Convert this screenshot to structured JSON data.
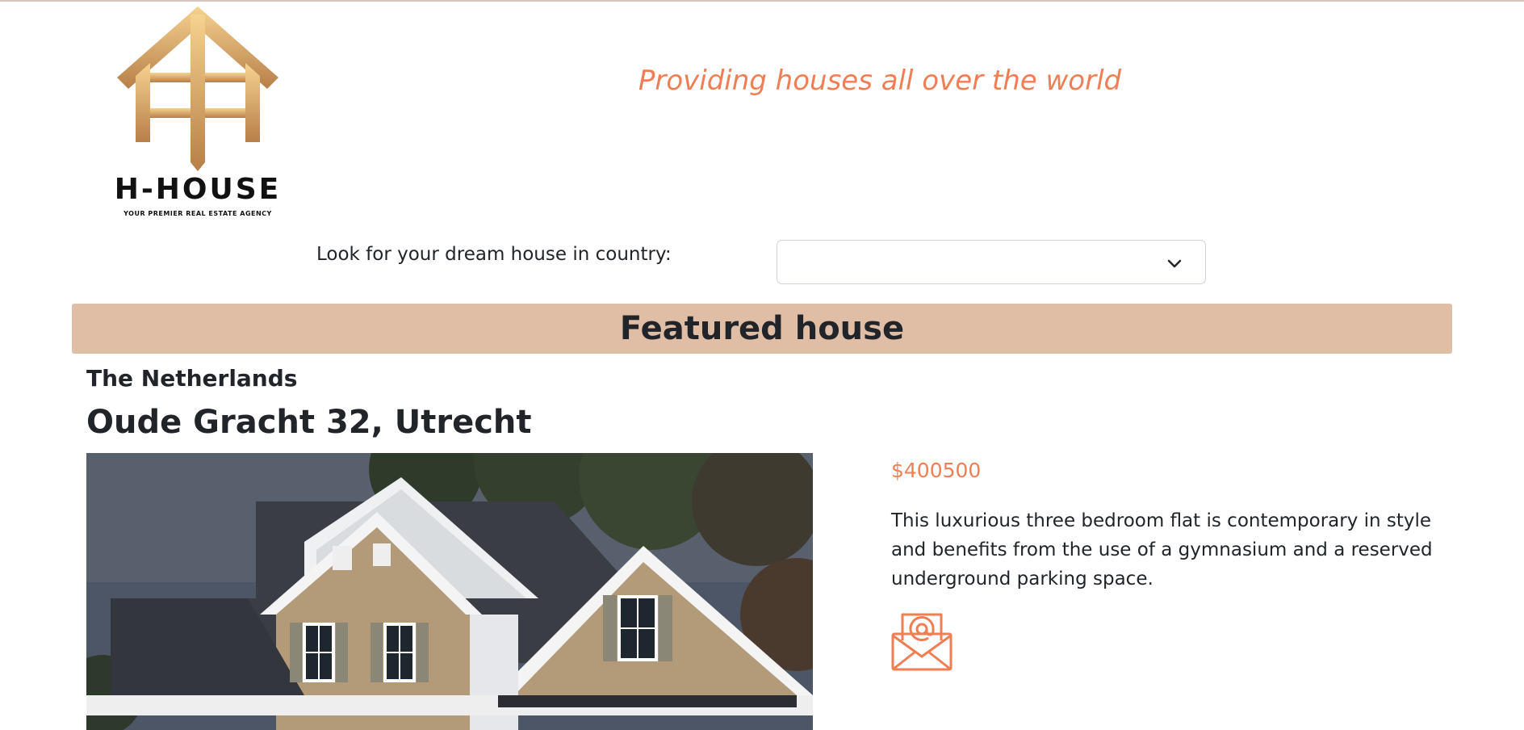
{
  "header": {
    "logo": {
      "name": "H-HOUSE",
      "tagline": "YOUR PREMIER REAL ESTATE AGENCY"
    },
    "slogan": "Providing houses all over the world"
  },
  "search": {
    "label": "Look for your dream house in country:",
    "selected_value": "",
    "chevron_icon": "chevron-down-icon"
  },
  "featured": {
    "banner_title": "Featured house",
    "country": "The Netherlands",
    "address": "Oude Gracht 32, Utrecht",
    "price": "$400500",
    "description": "This luxurious three bedroom flat is contemporary in style and benefits from the use of a gymnasium and a reserved underground parking space.",
    "contact_icon": "email-envelope-icon"
  },
  "colors": {
    "accent": "#f07e54",
    "banner": "#e0bda5",
    "logo_gold_light": "#f6d290",
    "logo_gold_dark": "#b77f49"
  }
}
